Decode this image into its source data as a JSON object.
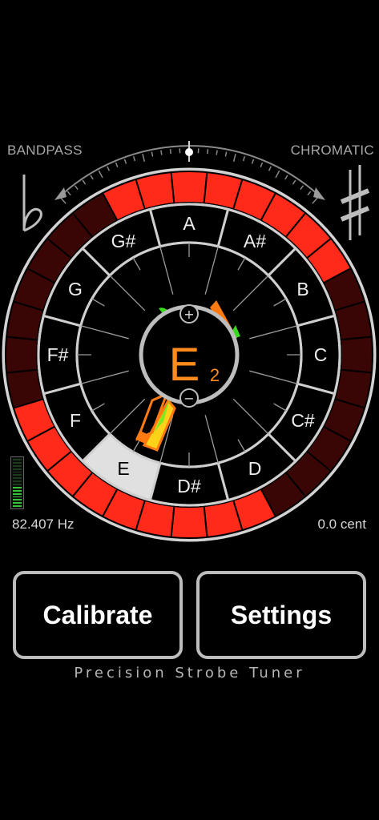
{
  "modes": {
    "left": "BANDPASS",
    "right": "CHROMATIC",
    "left_icon": "flat-icon",
    "right_icon": "sharp-icon"
  },
  "tuner": {
    "note_ring": [
      "A",
      "A#",
      "B",
      "C",
      "C#",
      "D",
      "D#",
      "E",
      "F",
      "F#",
      "G",
      "G#"
    ],
    "selected_note": "E",
    "current_note": "E",
    "current_octave": "2",
    "plus_label": "+",
    "minus_label": "−",
    "strobe_lit": [
      1,
      1,
      1,
      1,
      1,
      1,
      1,
      1,
      0,
      0,
      0,
      0,
      0,
      0,
      0,
      0,
      1,
      1,
      1,
      1,
      1,
      1,
      1,
      1,
      1,
      0,
      0,
      0,
      0,
      0,
      0,
      0
    ],
    "colors": {
      "strobe_on": "#ff2a1a",
      "strobe_off": "#3a0505",
      "note_text": "#ff8a1e",
      "ring": "#d8d8d8",
      "selected_fill": "#e0e0e0"
    }
  },
  "readouts": {
    "frequency": "82.407 Hz",
    "cents": "0.0 cent"
  },
  "signal_level": 0.45,
  "buttons": {
    "calibrate": "Calibrate",
    "settings": "Settings"
  },
  "footer": "Precision Strobe Tuner"
}
